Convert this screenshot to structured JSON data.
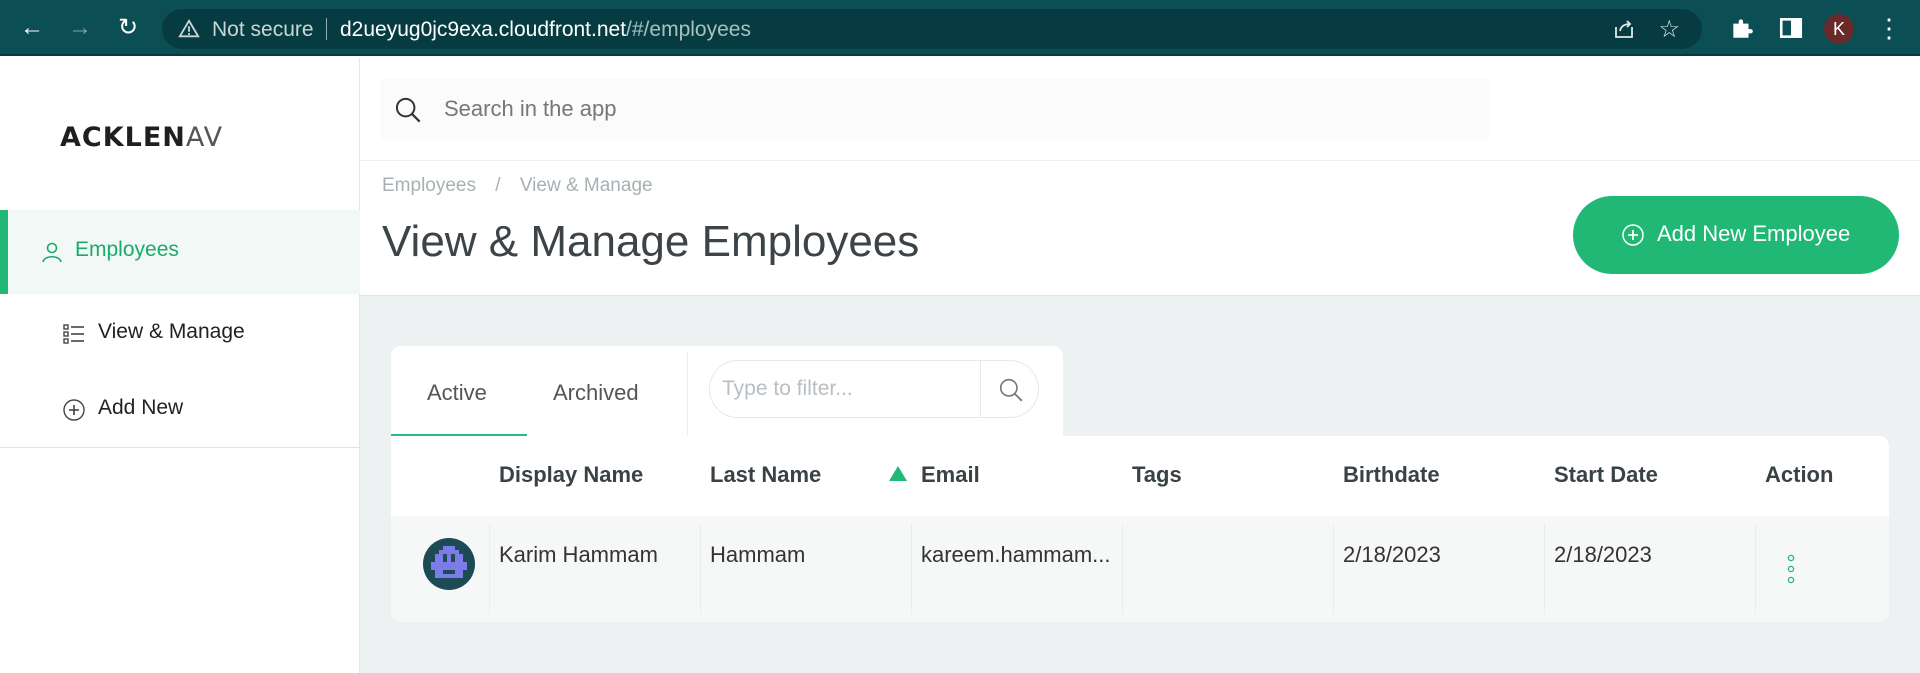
{
  "browser": {
    "not_secure": "Not secure",
    "url_host": "d2ueyug0jc9exa.cloudfront.net",
    "url_path": "/#/employees",
    "profile_initial": "K"
  },
  "app": {
    "logo_main": "ACKLEN",
    "logo_fade": "AV",
    "search_placeholder": "Search in the app",
    "accent_color": "#21b876"
  },
  "sidebar": {
    "items": [
      {
        "label": "Employees",
        "icon": "user-icon",
        "active": true
      },
      {
        "label": "View & Manage",
        "icon": "list-icon"
      },
      {
        "label": "Add New",
        "icon": "plus-circle-icon"
      }
    ]
  },
  "header": {
    "breadcrumb": [
      "Employees",
      "/",
      "View & Manage"
    ],
    "title": "View & Manage Employees",
    "add_button": "Add New Employee"
  },
  "tabs": [
    {
      "label": "Active",
      "active": true
    },
    {
      "label": "Archived"
    }
  ],
  "filter": {
    "placeholder": "Type to filter..."
  },
  "table": {
    "columns": [
      "Display Name",
      "Last Name",
      "Email",
      "Tags",
      "Birthdate",
      "Start Date",
      "Action"
    ],
    "sorted_column": "Email",
    "rows": [
      {
        "display_name": "Karim Hammam",
        "last_name": "Hammam",
        "email": "kareem.hammam...",
        "tags": "",
        "birthdate": "2/18/2023",
        "start_date": "2/18/2023"
      }
    ]
  }
}
